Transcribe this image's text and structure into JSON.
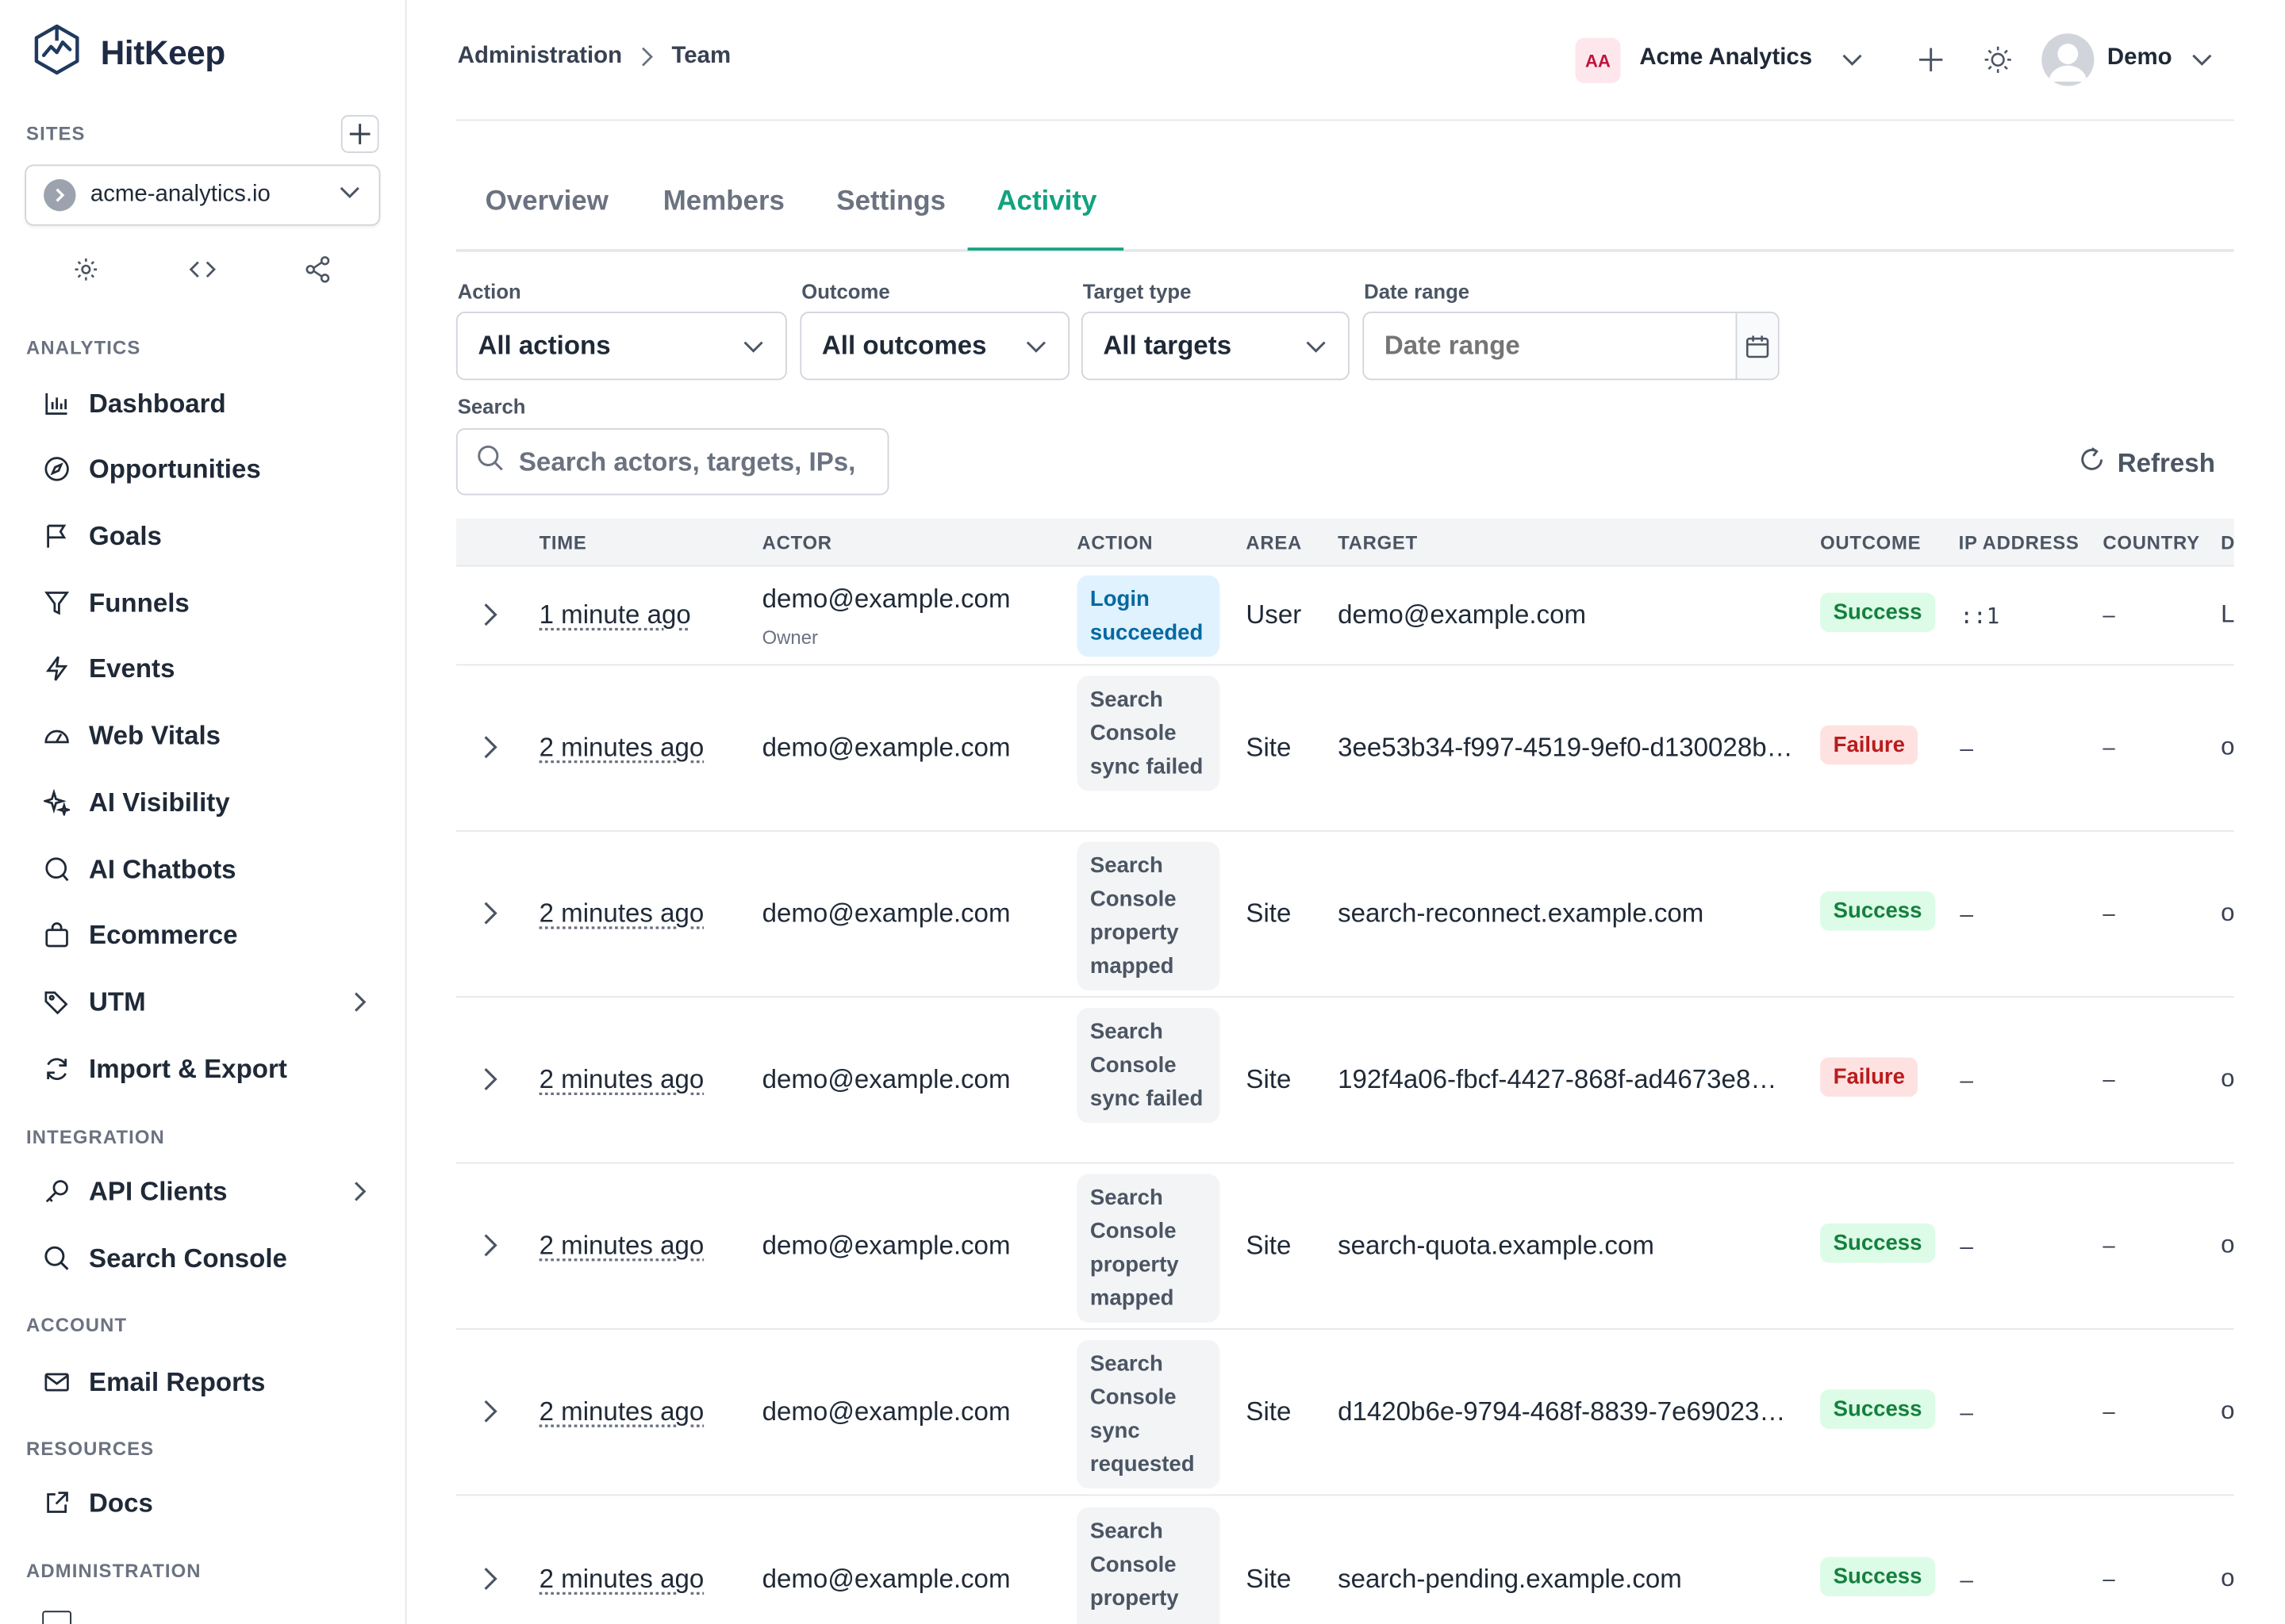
{
  "brand": {
    "name": "HitKeep"
  },
  "sidebar": {
    "sites_label": "SITES",
    "site": {
      "name": "acme-analytics.io"
    },
    "sections": [
      {
        "label": "ANALYTICS"
      },
      {
        "label": "INTEGRATION"
      },
      {
        "label": "ACCOUNT"
      },
      {
        "label": "RESOURCES"
      },
      {
        "label": "ADMINISTRATION"
      }
    ],
    "items": [
      {
        "label": "Dashboard",
        "icon": "bar-chart-icon"
      },
      {
        "label": "Opportunities",
        "icon": "compass-icon"
      },
      {
        "label": "Goals",
        "icon": "flag-icon"
      },
      {
        "label": "Funnels",
        "icon": "funnel-icon"
      },
      {
        "label": "Events",
        "icon": "bolt-icon"
      },
      {
        "label": "Web Vitals",
        "icon": "gauge-icon"
      },
      {
        "label": "AI Visibility",
        "icon": "sparkles-icon"
      },
      {
        "label": "AI Chatbots",
        "icon": "chat-icon"
      },
      {
        "label": "Ecommerce",
        "icon": "shopping-bag-icon"
      },
      {
        "label": "UTM",
        "icon": "tag-icon"
      },
      {
        "label": "Import & Export",
        "icon": "refresh-icon"
      },
      {
        "label": "API Clients",
        "icon": "key-icon"
      },
      {
        "label": "Search Console",
        "icon": "search-icon"
      },
      {
        "label": "Email Reports",
        "icon": "mail-icon"
      },
      {
        "label": "Docs",
        "icon": "external-link-icon"
      }
    ]
  },
  "header": {
    "breadcrumb": [
      "Administration",
      "Team"
    ],
    "org_initials": "AA",
    "org_name": "Acme Analytics",
    "user_name": "Demo"
  },
  "tabs": [
    "Overview",
    "Members",
    "Settings",
    "Activity"
  ],
  "active_tab": "Activity",
  "filters": {
    "action": {
      "label": "Action",
      "value": "All actions"
    },
    "outcome": {
      "label": "Outcome",
      "value": "All outcomes"
    },
    "target_type": {
      "label": "Target type",
      "value": "All targets"
    },
    "date_range": {
      "label": "Date range",
      "placeholder": "Date range"
    },
    "search": {
      "label": "Search",
      "placeholder": "Search actors, targets, IPs,"
    },
    "refresh_label": "Refresh"
  },
  "table": {
    "columns": [
      "TIME",
      "ACTOR",
      "ACTION",
      "AREA",
      "TARGET",
      "OUTCOME",
      "IP ADDRESS",
      "COUNTRY",
      "D"
    ],
    "rows": [
      {
        "time": "1 minute ago",
        "actor": "demo@example.com",
        "actor_role": "Owner",
        "action": "Login succeeded",
        "area": "User",
        "target": "demo@example.com",
        "outcome": "Success",
        "ip": "::1",
        "country": "–",
        "extra": "L"
      },
      {
        "time": "2 minutes ago",
        "actor": "demo@example.com",
        "action": "Search Console sync failed",
        "area": "Site",
        "target": "3ee53b34-f997-4519-9ef0-d130028b…",
        "outcome": "Failure",
        "ip": "–",
        "country": "–",
        "extra": "o"
      },
      {
        "time": "2 minutes ago",
        "actor": "demo@example.com",
        "action": "Search Console property mapped",
        "area": "Site",
        "target": "search-reconnect.example.com",
        "outcome": "Success",
        "ip": "–",
        "country": "–",
        "extra": "o"
      },
      {
        "time": "2 minutes ago",
        "actor": "demo@example.com",
        "action": "Search Console sync failed",
        "area": "Site",
        "target": "192f4a06-fbcf-4427-868f-ad4673e8…",
        "outcome": "Failure",
        "ip": "–",
        "country": "–",
        "extra": "o"
      },
      {
        "time": "2 minutes ago",
        "actor": "demo@example.com",
        "action": "Search Console property mapped",
        "area": "Site",
        "target": "search-quota.example.com",
        "outcome": "Success",
        "ip": "–",
        "country": "–",
        "extra": "o"
      },
      {
        "time": "2 minutes ago",
        "actor": "demo@example.com",
        "action": "Search Console sync requested",
        "area": "Site",
        "target": "d1420b6e-9794-468f-8839-7e69023…",
        "outcome": "Success",
        "ip": "–",
        "country": "–",
        "extra": "o"
      },
      {
        "time": "2 minutes ago",
        "actor": "demo@example.com",
        "action": "Search Console property",
        "area": "Site",
        "target": "search-pending.example.com",
        "outcome": "Success",
        "ip": "–",
        "country": "–",
        "extra": "o"
      }
    ]
  },
  "colors": {
    "accent": "#10a37f",
    "success_bg": "#dcfce7",
    "success_fg": "#15803d",
    "failure_bg": "#fee2e2",
    "failure_fg": "#b91c1c",
    "login_pill_bg": "#e0f2fe",
    "org_badge_bg": "#fde7ec"
  }
}
